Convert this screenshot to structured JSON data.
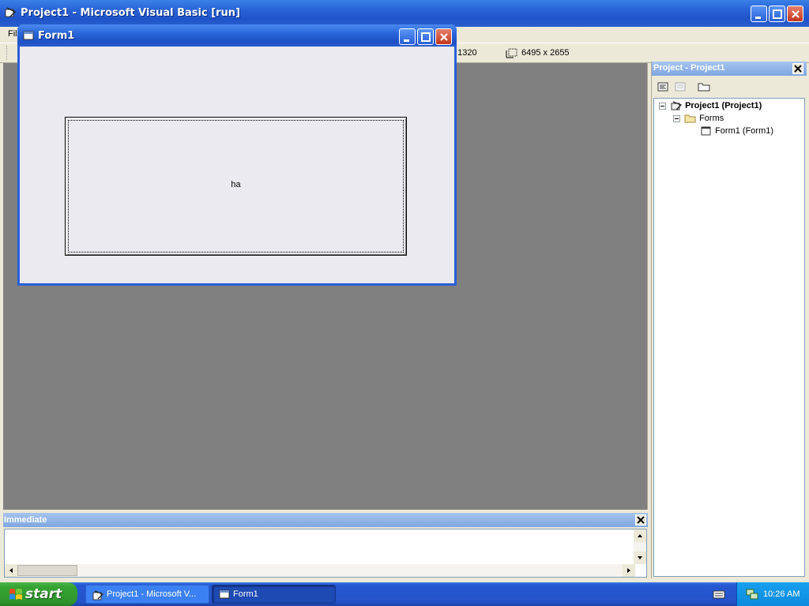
{
  "main_window": {
    "title": "Project1 - Microsoft Visual Basic [run]",
    "menu_visible_fragment": "Fil",
    "toolbar_position_fragment": ", 1320",
    "toolbar_size": "6495 x 2655"
  },
  "project_panel": {
    "title": "Project - Project1",
    "tree": {
      "project": "Project1 (Project1)",
      "folder": "Forms",
      "form": "Form1 (Form1)"
    }
  },
  "immediate": {
    "title": "Immediate"
  },
  "form_window": {
    "title": "Form1",
    "command_button_caption": "ha"
  },
  "taskbar": {
    "start_label": "start",
    "tasks": [
      {
        "label": "Project1 - Microsoft V..."
      },
      {
        "label": "Form1"
      }
    ],
    "clock": "10:26 AM"
  },
  "colors": {
    "title_blue": "#2a65d8",
    "workspace_gray": "#808080",
    "start_green": "#34a331",
    "tray_blue": "#0d8adc"
  }
}
